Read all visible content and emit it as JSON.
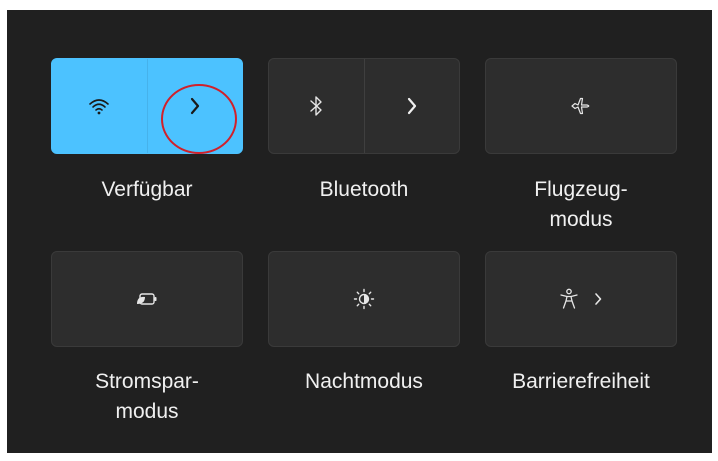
{
  "panel": {
    "tiles": [
      {
        "label": "Verfügbar",
        "icon": "wifi-icon",
        "expand_icon": "chevron-right-icon",
        "state": "on"
      },
      {
        "label": "Bluetooth",
        "icon": "bluetooth-icon",
        "expand_icon": "chevron-right-icon",
        "state": "off"
      },
      {
        "label_line1": "Flugzeug-",
        "label_line2": "modus",
        "icon": "airplane-icon",
        "state": "off"
      },
      {
        "label_line1": "Stromspar-",
        "label_line2": "modus",
        "icon": "battery-saver-icon",
        "state": "off"
      },
      {
        "label": "Nachtmodus",
        "icon": "night-light-icon",
        "state": "off"
      },
      {
        "label": "Barrierefreiheit",
        "icon": "accessibility-icon",
        "expand_icon": "chevron-right-icon",
        "state": "off"
      }
    ]
  },
  "colors": {
    "panel_bg": "#202020",
    "tile_bg": "#2d2d2d",
    "accent": "#4cc2ff",
    "annotation": "#d1202a"
  }
}
